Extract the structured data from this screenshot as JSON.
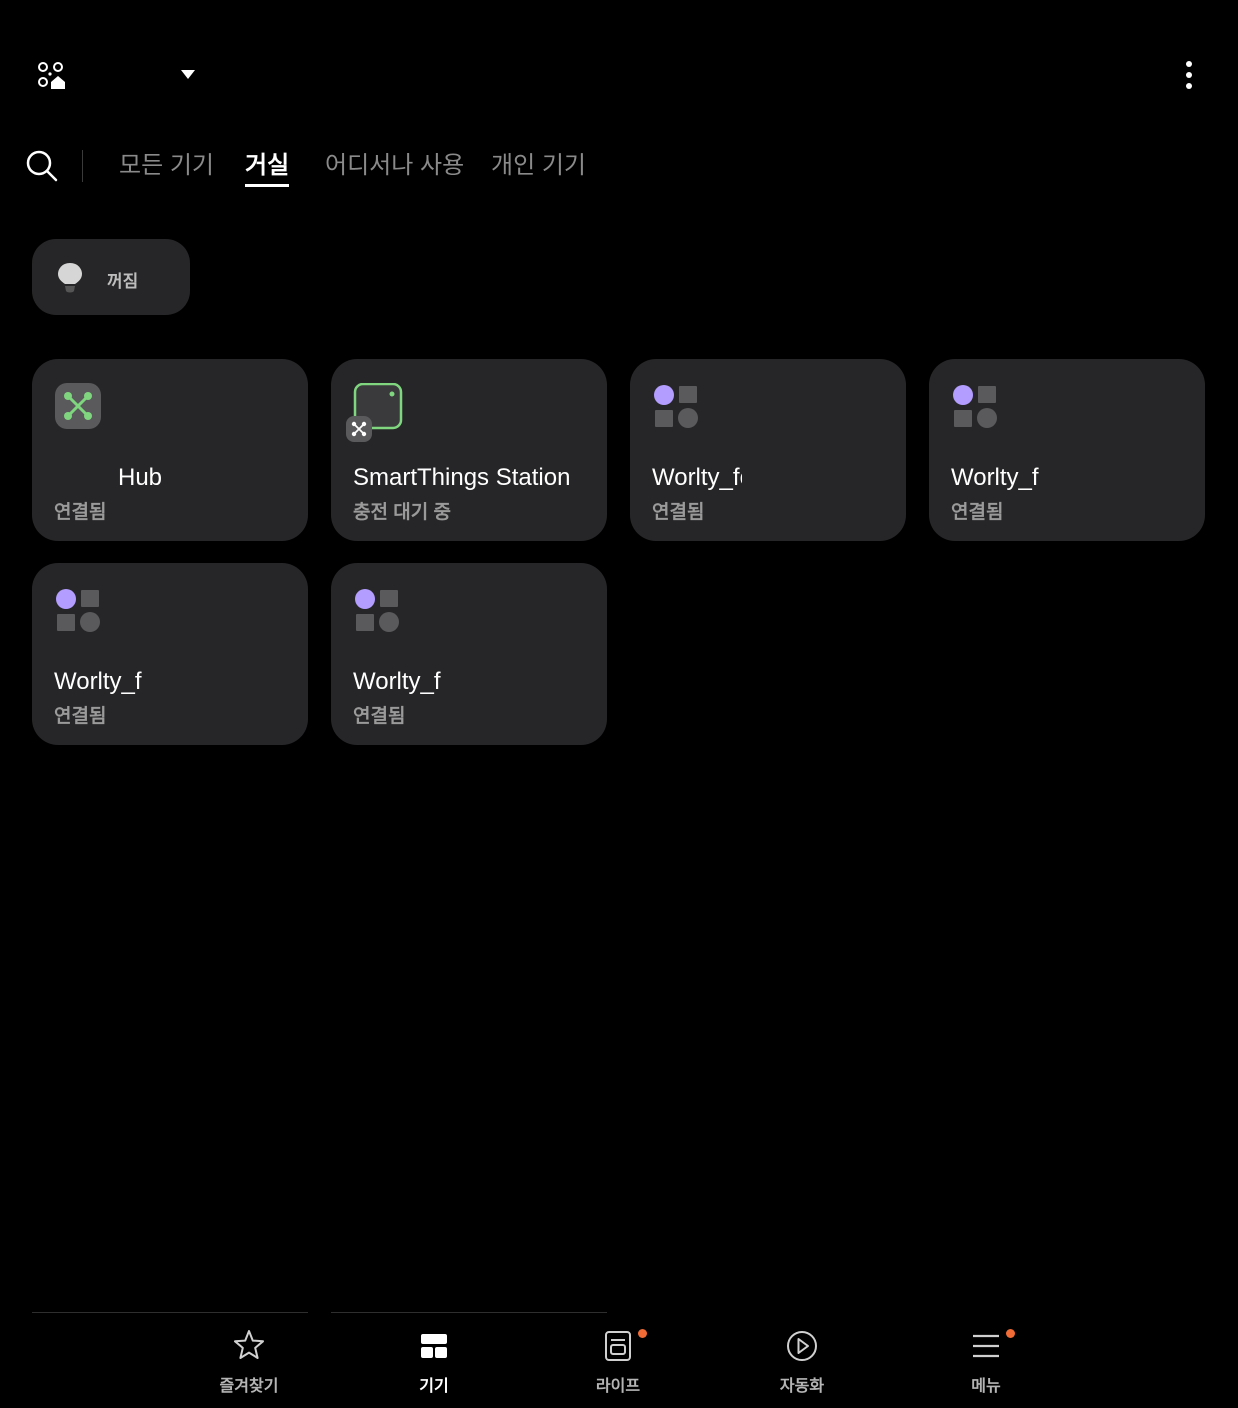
{
  "header": {
    "home_icon": "home-locations-icon",
    "dropdown_icon": "dropdown-arrow-icon",
    "more_icon": "more-vertical-icon"
  },
  "tabs": [
    {
      "label": "모든 기기",
      "active": false
    },
    {
      "label": "거실",
      "active": true
    },
    {
      "label": "어디서나 사용",
      "active": false
    },
    {
      "label": "개인 기기",
      "active": false
    }
  ],
  "light_chip": {
    "label": "꺼짐",
    "icon": "bulb-icon"
  },
  "devices": [
    {
      "name": "Hub",
      "status": "연결됨",
      "icon": "hub-icon"
    },
    {
      "name": "SmartThings Station",
      "status": "충전 대기 중",
      "icon": "station-icon"
    },
    {
      "name": "Worlty_fc",
      "status": "연결됨",
      "icon": "generic-device-icon"
    },
    {
      "name": "Worlty_fc",
      "status": "연결됨",
      "icon": "generic-device-icon"
    },
    {
      "name": "Worlty_f",
      "status": "연결됨",
      "icon": "generic-device-icon"
    },
    {
      "name": "Worlty_f",
      "status": "연결됨",
      "icon": "generic-device-icon"
    }
  ],
  "bottom_nav": [
    {
      "label": "즐겨찾기",
      "icon": "star-icon",
      "active": false,
      "badge": false
    },
    {
      "label": "기기",
      "icon": "devices-grid-icon",
      "active": true,
      "badge": false
    },
    {
      "label": "라이프",
      "icon": "life-icon",
      "active": false,
      "badge": true
    },
    {
      "label": "자동화",
      "icon": "automation-play-icon",
      "active": false,
      "badge": false
    },
    {
      "label": "메뉴",
      "icon": "menu-icon",
      "active": false,
      "badge": true
    }
  ],
  "colors": {
    "background": "#000000",
    "card": "#262628",
    "accent_purple": "#b39dff",
    "hub_green": "#7fd67f",
    "badge_orange": "#f06b35"
  }
}
